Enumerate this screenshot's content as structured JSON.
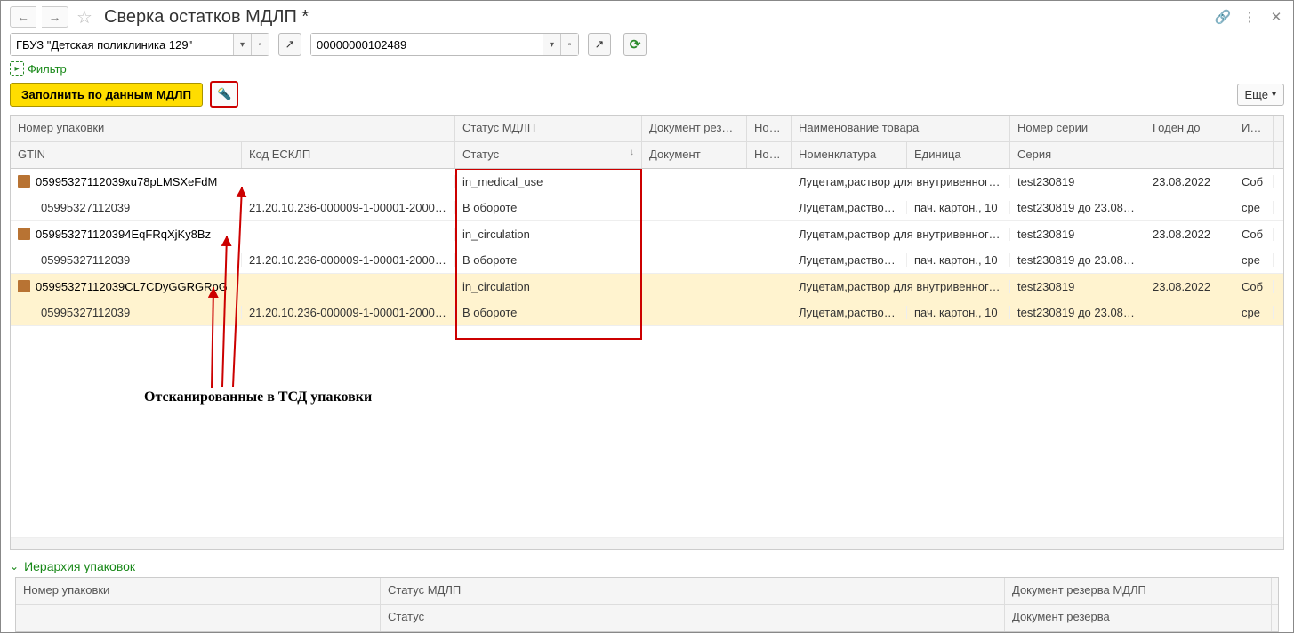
{
  "title": "Сверка остатков МДЛП *",
  "combo1": {
    "value": "ГБУЗ \"Детская поликлиника 129\""
  },
  "combo2": {
    "value": "00000000102489"
  },
  "filter_label": "Фильтр",
  "fill_button": "Заполнить по данным МДЛП",
  "more_button": "Еще",
  "headers1": {
    "pack": "Номер упаковки",
    "status": "Статус МДЛП",
    "dres": "Документ резе…",
    "nom": "Ном…",
    "name": "Наименование товара",
    "ser": "Номер серии",
    "exp": "Годен до",
    "fin": "Ист фин"
  },
  "headers2": {
    "gtin": "GTIN",
    "esklp": "Код ЕСКЛП",
    "status": "Статус",
    "doc": "Документ",
    "num": "Номер",
    "nomen": "Номенклатура",
    "unit": "Единица",
    "seria": "Серия",
    "exp": "",
    "fin": ""
  },
  "rows": [
    {
      "selected": true,
      "top": {
        "pkg": "05995327112039CL7CDyGGRGRpG",
        "status": "in_circulation",
        "name": "Луцетам,раствор для внутривенного…",
        "ser": "test230819",
        "exp": "23.08.2022",
        "fin": "Соб"
      },
      "bot": {
        "gtin": "05995327112039",
        "esklp": "21.20.10.236-000009-1-00001-20000…",
        "status": "В обороте",
        "nomen": "Луцетам,раствор…",
        "unit": "пач. картон., 10",
        "seria": "test230819 до 23.08.2022",
        "fin": "сре"
      }
    },
    {
      "selected": false,
      "top": {
        "pkg": "059953271120394EqFRqXjKy8Bz",
        "status": "in_circulation",
        "name": "Луцетам,раствор для внутривенного…",
        "ser": "test230819",
        "exp": "23.08.2022",
        "fin": "Соб"
      },
      "bot": {
        "gtin": "05995327112039",
        "esklp": "21.20.10.236-000009-1-00001-20000…",
        "status": "В обороте",
        "nomen": "Луцетам,раствор…",
        "unit": "пач. картон., 10",
        "seria": "test230819 до 23.08.2022",
        "fin": "сре"
      }
    },
    {
      "selected": false,
      "top": {
        "pkg": "05995327112039xu78pLMSXeFdM",
        "status": "in_medical_use",
        "name": "Луцетам,раствор для внутривенного…",
        "ser": "test230819",
        "exp": "23.08.2022",
        "fin": "Соб"
      },
      "bot": {
        "gtin": "05995327112039",
        "esklp": "21.20.10.236-000009-1-00001-20000…",
        "status": "В обороте",
        "nomen": "Луцетам,раствор…",
        "unit": "пач. картон., 10",
        "seria": "test230819 до 23.08.2022",
        "fin": "сре"
      }
    }
  ],
  "annotation_text": "Отсканированные в ТСД упаковки",
  "hier_title": "Иерархия упаковок",
  "hier_headers": {
    "pack": "Номер упаковки",
    "status1": "Статус МДЛП",
    "status2": "Статус",
    "dres1": "Документ резерва МДЛП",
    "dres2": "Документ резерва"
  }
}
